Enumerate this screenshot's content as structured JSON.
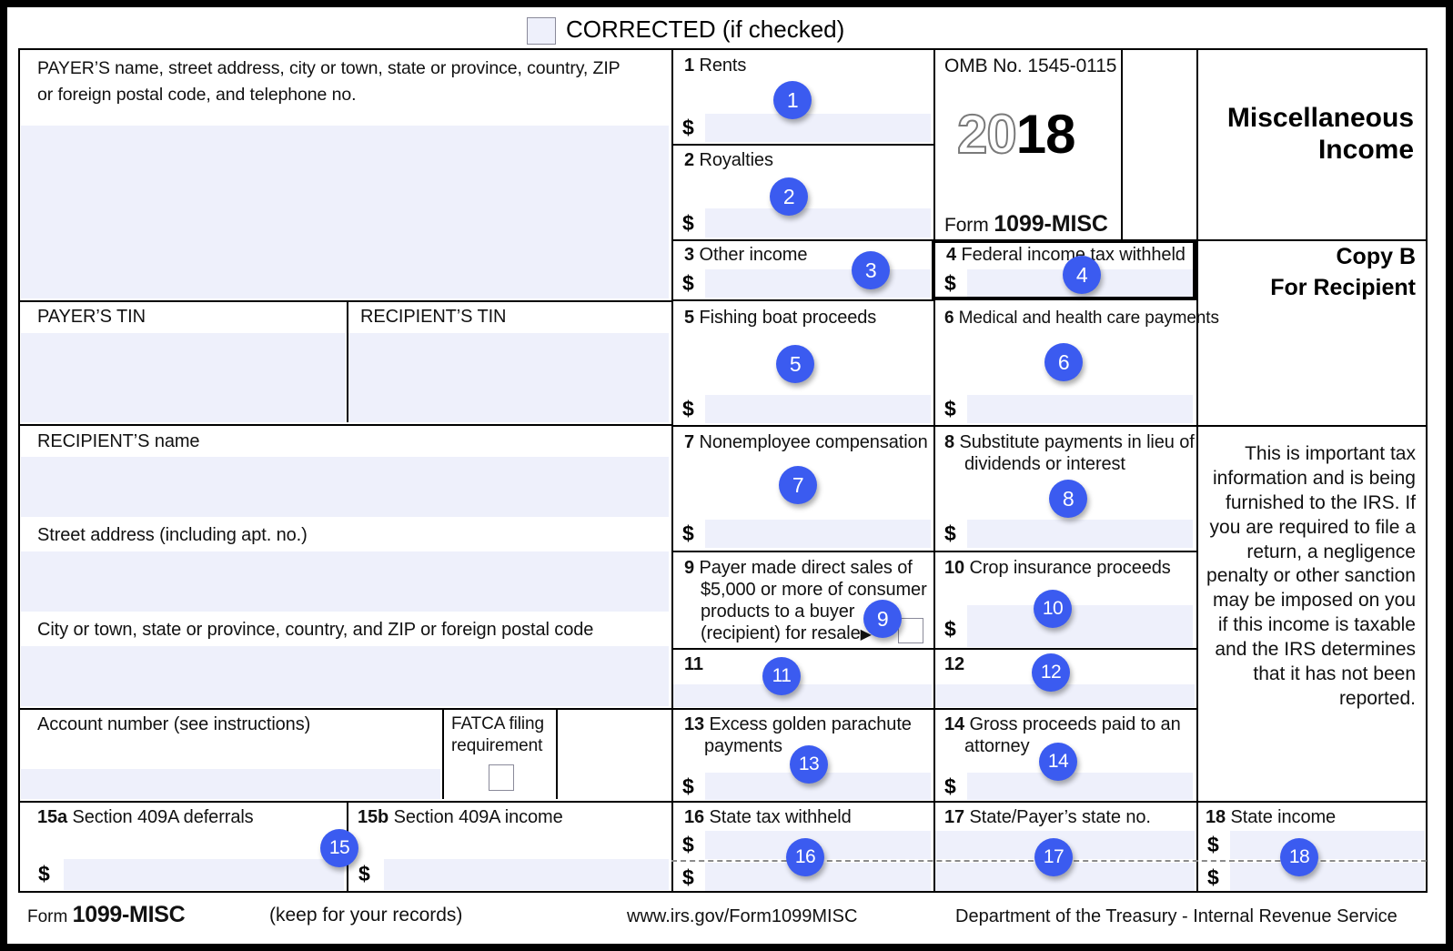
{
  "form": {
    "corrected_label": "CORRECTED (if checked)",
    "omb": "OMB No. 1545-0115",
    "year_hollow": "20",
    "year_solid": "18",
    "form_prefix": "Form",
    "form_number": "1099-MISC",
    "title_line1": "Miscellaneous",
    "title_line2": "Income",
    "copy_line1": "Copy B",
    "copy_line2": "For Recipient",
    "notice": "This is important tax information and is being furnished to the IRS. If you are required to file a return, a negligence penalty or other sanction may be imposed on you if this income is taxable and the IRS determines that it has not been reported."
  },
  "left": {
    "payer_block_line1": "PAYER’S name, street address, city or town, state or province, country, ZIP",
    "payer_block_line2": "or foreign postal code, and telephone no.",
    "payer_tin": "PAYER’S TIN",
    "recipient_tin": "RECIPIENT’S TIN",
    "recipient_name": "RECIPIENT’S name",
    "street_address": "Street address (including apt. no.)",
    "city_state_zip": "City or town, state or province, country, and ZIP or foreign postal code",
    "account_number": "Account number (see instructions)",
    "fatca_line1": "FATCA filing",
    "fatca_line2": "requirement"
  },
  "boxes": {
    "b1": {
      "num": "1",
      "label": "Rents",
      "badge": "1"
    },
    "b2": {
      "num": "2",
      "label": "Royalties",
      "badge": "2"
    },
    "b3": {
      "num": "3",
      "label": "Other income",
      "badge": "3"
    },
    "b4": {
      "num": "4",
      "label": "Federal income tax withheld",
      "badge": "4"
    },
    "b5": {
      "num": "5",
      "label": "Fishing boat proceeds",
      "badge": "5"
    },
    "b6": {
      "num": "6",
      "label": "Medical and health care payments",
      "badge": "6"
    },
    "b7": {
      "num": "7",
      "label": "Nonemployee compensation",
      "badge": "7"
    },
    "b8": {
      "num": "8",
      "label_line1": "Substitute payments in lieu of",
      "label_line2": "dividends or interest",
      "badge": "8"
    },
    "b9": {
      "num": "9",
      "label_line1": "Payer made direct sales of",
      "label_line2": "$5,000 or more of consumer",
      "label_line3": "products to a buyer",
      "label_line4": "(recipient) for resale",
      "arrow": "▶",
      "badge": "9"
    },
    "b10": {
      "num": "10",
      "label": "Crop insurance proceeds",
      "badge": "10"
    },
    "b11": {
      "num": "11",
      "label": "",
      "badge": "11"
    },
    "b12": {
      "num": "12",
      "label": "",
      "badge": "12"
    },
    "b13": {
      "num": "13",
      "label_line1": "Excess golden parachute",
      "label_line2": "payments",
      "badge": "13"
    },
    "b14": {
      "num": "14",
      "label_line1": "Gross proceeds paid to an",
      "label_line2": "attorney",
      "badge": "14"
    },
    "b15a": {
      "num": "15a",
      "label": "Section 409A deferrals",
      "badge": "15"
    },
    "b15b": {
      "num": "15b",
      "label": "Section 409A income"
    },
    "b16": {
      "num": "16",
      "label": "State tax withheld",
      "badge": "16"
    },
    "b17": {
      "num": "17",
      "label": "State/Payer’s state no.",
      "badge": "17"
    },
    "b18": {
      "num": "18",
      "label": "State income",
      "badge": "18"
    }
  },
  "footer": {
    "form_prefix": "Form",
    "form_number": "1099-MISC",
    "keep": "(keep for your records)",
    "url": "www.irs.gov/Form1099MISC",
    "dept": "Department of the Treasury - Internal Revenue Service"
  },
  "symbols": {
    "dollar": "$"
  },
  "colors": {
    "badge": "#3b5bf0",
    "field_fill": "#eef0fb",
    "frame": "#000000"
  }
}
